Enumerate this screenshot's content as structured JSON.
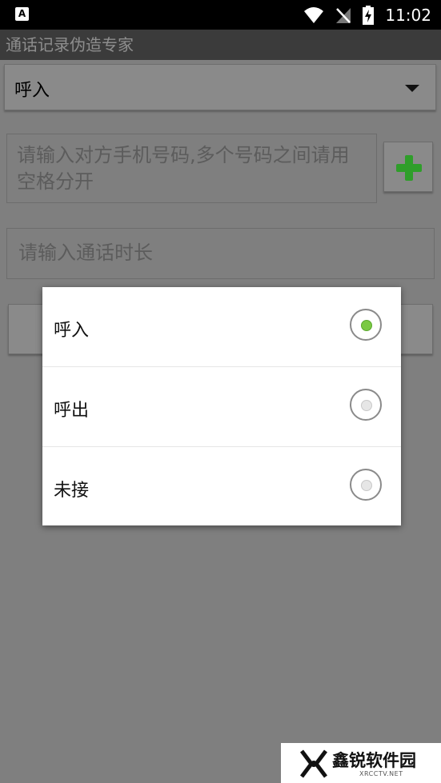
{
  "status_bar": {
    "time": "11:02",
    "left_icon": "A",
    "icons": [
      "wifi-icon",
      "no-signal-icon",
      "battery-charging-icon"
    ]
  },
  "app": {
    "title": "通话记录伪造专家"
  },
  "call_type_spinner": {
    "selected": "呼入"
  },
  "phone_input": {
    "placeholder": "请输入对方手机号码,多个号码之间请用空格分开"
  },
  "duration_input": {
    "placeholder": "请输入通话时长"
  },
  "dialog": {
    "options": [
      {
        "label": "呼入",
        "checked": true
      },
      {
        "label": "呼出",
        "checked": false
      },
      {
        "label": "未接",
        "checked": false
      }
    ]
  },
  "watermark": {
    "name": "鑫锐软件园",
    "url": "XRCCTV.NET"
  },
  "colors": {
    "accent_green": "#7ac943",
    "plus_green": "#2f9e2a",
    "dim_overlay": "#7f7f7f"
  }
}
